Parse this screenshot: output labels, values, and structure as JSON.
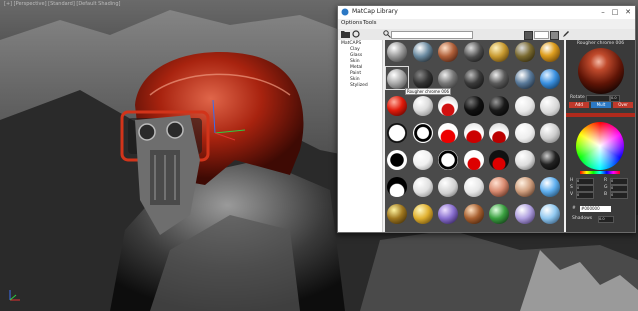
{
  "viewport": {
    "label": "[+] [Perspective] [Standard] [Default Shading]"
  },
  "window": {
    "title": "MatCap Library",
    "menus": [
      "Options",
      "Tools"
    ]
  },
  "tree": {
    "root": "MatCAPS",
    "items": [
      "Clay",
      "Glass",
      "Skin",
      "Metal",
      "Paint",
      "Skin",
      "Stylized"
    ]
  },
  "tooltip": "Rougher chrome 006",
  "side": {
    "material_name": "Rougher chrome 006",
    "rotate_label": "Rotate",
    "rotate_value": "0.0",
    "blend_buttons": [
      "Add",
      "Mult",
      "Over"
    ],
    "rgb_labels": [
      "H",
      "S",
      "V"
    ],
    "rgb_values": [
      "0",
      "0",
      "0"
    ],
    "rgb2_labels": [
      "R",
      "G",
      "B"
    ],
    "rgb2_values": [
      "0",
      "0",
      "0"
    ],
    "hex_label": "#",
    "hex_value": "#000000",
    "shadows_label": "Shadows",
    "shadows_value": "0.0"
  },
  "colors": {
    "accent_red": "#c0392b",
    "blend_active": "#2b78c4",
    "helmet_red": "#b52a14"
  },
  "spheres": [
    "silver",
    "chrome",
    "copper",
    "gunmetal",
    "gold",
    "dark-gold",
    "gold-shiny",
    "silver2",
    "dark",
    "smoke",
    "dark2",
    "gunmetal2",
    "blue-steel",
    "blue-chrome",
    "red",
    "gloss-white",
    "white-red",
    "black",
    "black2",
    "white",
    "matte-white",
    "toon-white",
    "toon-ring",
    "toon-red",
    "red-white",
    "red-white2",
    "white2",
    "gray-white",
    "toon-black",
    "white3",
    "toon-ring2",
    "toon-red2",
    "red-black",
    "white4",
    "dark-chrome",
    "white-black",
    "white-shiny",
    "white5",
    "white6",
    "salmon",
    "skin",
    "blue-light",
    "gold-cube",
    "gold-sphere",
    "purple",
    "bronze",
    "green",
    "lavender",
    "blue-pale"
  ]
}
